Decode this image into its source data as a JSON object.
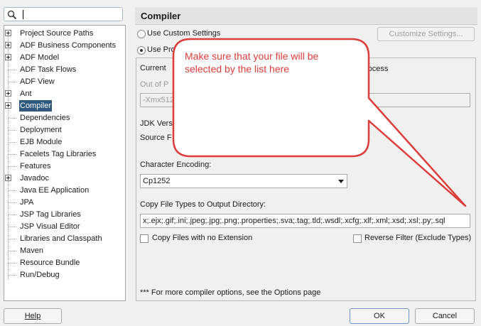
{
  "search": {
    "value": ""
  },
  "tree": {
    "items": [
      {
        "label": "Project Source Paths",
        "expandable": true
      },
      {
        "label": "ADF Business Components",
        "expandable": true
      },
      {
        "label": "ADF Model",
        "expandable": true
      },
      {
        "label": "ADF Task Flows",
        "expandable": false
      },
      {
        "label": "ADF View",
        "expandable": false
      },
      {
        "label": "Ant",
        "expandable": true
      },
      {
        "label": "Compiler",
        "expandable": true,
        "selected": true
      },
      {
        "label": "Dependencies",
        "expandable": false
      },
      {
        "label": "Deployment",
        "expandable": false
      },
      {
        "label": "EJB Module",
        "expandable": false
      },
      {
        "label": "Facelets Tag Libraries",
        "expandable": false
      },
      {
        "label": "Features",
        "expandable": false
      },
      {
        "label": "Javadoc",
        "expandable": true
      },
      {
        "label": "Java EE Application",
        "expandable": false
      },
      {
        "label": "JPA",
        "expandable": false
      },
      {
        "label": "JSP Tag Libraries",
        "expandable": false
      },
      {
        "label": "JSP Visual Editor",
        "expandable": false
      },
      {
        "label": "Libraries and Classpath",
        "expandable": false
      },
      {
        "label": "Maven",
        "expandable": false
      },
      {
        "label": "Resource Bundle",
        "expandable": false
      },
      {
        "label": "Run/Debug",
        "expandable": false
      }
    ]
  },
  "header": {
    "title": "Compiler"
  },
  "settings": {
    "use_custom": "Use Custom Settings",
    "use_project": "Use Proj",
    "customize_button": "Customize Settings..."
  },
  "panel": {
    "current_label": "Current",
    "process_text": "rocess",
    "out_of_label": "Out of P",
    "xmx_value": "-Xmx512",
    "jdk_label": "JDK Vers",
    "source_label": "Source F",
    "encoding_label": "Character Encoding:",
    "encoding_value": "Cp1252",
    "copy_types_label": "Copy File Types to Output Directory:",
    "copy_types_value": "x;.ejx;.gif;.ini;.jpeg;.jpg;.png;.properties;.sva;.tag;.tld;.wsdl;.xcfg;.xlf;.xml;.xsd;.xsl;.py;.sql",
    "copy_no_ext": "Copy Files with no Extension",
    "reverse_filter": "Reverse Filter (Exclude Types)",
    "footnote": "*** For more compiler options, see the Options page"
  },
  "callout": {
    "line1": "Make sure that your file will be",
    "line2": "selected by the list here",
    "color": "#dd3d3a"
  },
  "buttons": {
    "help": "Help",
    "ok": "OK",
    "cancel": "Cancel"
  }
}
